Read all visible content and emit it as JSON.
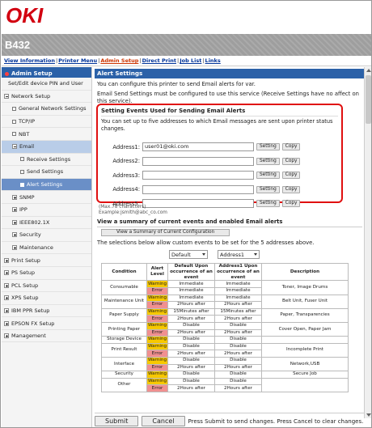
{
  "brand": {
    "logo": "OKI",
    "model": "B432"
  },
  "nav_links": [
    "View Information",
    "Printer Menu",
    "Admin Setup",
    "Direct Print",
    "Job List",
    "Links"
  ],
  "nav_active": "Admin Setup",
  "sidebar": {
    "header": "Admin Setup",
    "items": [
      {
        "label": "Set/Edit device PIN and User",
        "level": 0,
        "icon": "none"
      },
      {
        "label": "Network Setup",
        "level": 0,
        "icon": "minus"
      },
      {
        "label": "General Network Settings",
        "level": 1,
        "icon": "page"
      },
      {
        "label": "TCP/IP",
        "level": 1,
        "icon": "page"
      },
      {
        "label": "NBT",
        "level": 1,
        "icon": "page"
      },
      {
        "label": "Email",
        "level": 1,
        "icon": "minus",
        "state": "parent"
      },
      {
        "label": "Receive Settings",
        "level": 2,
        "icon": "page"
      },
      {
        "label": "Send Settings",
        "level": 2,
        "icon": "page"
      },
      {
        "label": "Alert Settings",
        "level": 2,
        "icon": "page",
        "state": "selected"
      },
      {
        "label": "SNMP",
        "level": 1,
        "icon": "plus"
      },
      {
        "label": "IPP",
        "level": 1,
        "icon": "plus"
      },
      {
        "label": "IEEE802.1X",
        "level": 1,
        "icon": "plus"
      },
      {
        "label": "Security",
        "level": 1,
        "icon": "plus"
      },
      {
        "label": "Maintenance",
        "level": 1,
        "icon": "plus"
      },
      {
        "label": "Print Setup",
        "level": 0,
        "icon": "plus"
      },
      {
        "label": "PS Setup",
        "level": 0,
        "icon": "plus"
      },
      {
        "label": "PCL Setup",
        "level": 0,
        "icon": "plus"
      },
      {
        "label": "XPS Setup",
        "level": 0,
        "icon": "plus"
      },
      {
        "label": "IBM PPR Setup",
        "level": 0,
        "icon": "plus"
      },
      {
        "label": "EPSON FX Setup",
        "level": 0,
        "icon": "plus"
      },
      {
        "label": "Management",
        "level": 0,
        "icon": "plus"
      }
    ]
  },
  "main": {
    "title": "Alert Settings",
    "intro": "You can configure this printer to send Email alerts for var.",
    "note": "Email Send Settings must be configured to use this service (Receive Settings have no affect on this service).",
    "box": {
      "title": "Setting Events Used for Sending Email Alerts",
      "desc": "You can set up to five addresses to which Email messages are sent upon printer status changes.",
      "addresses": [
        {
          "label": "Address1:",
          "value": "user01@oki.com"
        },
        {
          "label": "Address2:",
          "value": ""
        },
        {
          "label": "Address3:",
          "value": ""
        },
        {
          "label": "Address4:",
          "value": ""
        },
        {
          "label": "Address5:",
          "value": ""
        }
      ],
      "setting_btn": "Setting",
      "copy_btn": "Copy"
    },
    "max_note": "(Max.78 characters)",
    "example": "Example:jsmith@abc_co.com",
    "summary_title": "View a summary of current events and enabled Email alerts",
    "summary_btn": "View a Summary of Current Configuration",
    "selection_desc": "The selections below allow custom events to be set for the 5 addresses above.",
    "dropdown_left": "Default",
    "dropdown_right": "Address1",
    "table": {
      "headers": [
        "Condition",
        "Alert Level",
        "Default Upon occurrence of an event",
        "Address1 Upon occurrence of an event",
        "Description"
      ],
      "groups": [
        {
          "condition": "Consumable",
          "description": "Toner, Image Drums",
          "rows": [
            {
              "level": "Warning",
              "def": "Immediate",
              "addr": "Immediate"
            },
            {
              "level": "Error",
              "def": "Immediate",
              "addr": "Immediate"
            }
          ]
        },
        {
          "condition": "Maintenance Unit",
          "description": "Belt Unit, Fuser Unit",
          "rows": [
            {
              "level": "Warning",
              "def": "Immediate",
              "addr": "Immediate"
            },
            {
              "level": "Error",
              "def": "2Hours after",
              "addr": "2Hours after"
            }
          ]
        },
        {
          "condition": "Paper Supply",
          "description": "Paper, Transparencies",
          "rows": [
            {
              "level": "Warning",
              "def": "15Minutes after",
              "addr": "15Minutes after"
            },
            {
              "level": "Error",
              "def": "2Hours after",
              "addr": "2Hours after"
            }
          ]
        },
        {
          "condition": "Printing Paper",
          "description": "Cover Open, Paper Jam",
          "rows": [
            {
              "level": "Warning",
              "def": "Disable",
              "addr": "Disable"
            },
            {
              "level": "Error",
              "def": "2Hours after",
              "addr": "2Hours after"
            }
          ]
        },
        {
          "condition": "Storage Device",
          "description": "",
          "rows": [
            {
              "level": "Warning",
              "def": "Disable",
              "addr": "Disable"
            }
          ]
        },
        {
          "condition": "Print Result",
          "description": "Incomplete Print",
          "rows": [
            {
              "level": "Warning",
              "def": "Disable",
              "addr": "Disable"
            },
            {
              "level": "Error",
              "def": "2Hours after",
              "addr": "2Hours after"
            }
          ]
        },
        {
          "condition": "Interface",
          "description": "Network,USB",
          "rows": [
            {
              "level": "Warning",
              "def": "Disable",
              "addr": "Disable"
            },
            {
              "level": "Error",
              "def": "2Hours after",
              "addr": "2Hours after"
            }
          ]
        },
        {
          "condition": "Security",
          "description": "Secure Job",
          "rows": [
            {
              "level": "Warning",
              "def": "Disable",
              "addr": "Disable"
            }
          ]
        },
        {
          "condition": "Other",
          "description": "",
          "rows": [
            {
              "level": "Warning",
              "def": "Disable",
              "addr": "Disable"
            },
            {
              "level": "Error",
              "def": "2Hours after",
              "addr": "2Hours after"
            }
          ]
        }
      ]
    }
  },
  "footer": {
    "submit": "Submit",
    "cancel": "Cancel",
    "text": "Press Submit to send changes. Press Cancel to clear changes."
  },
  "colors": {
    "brand_red": "#d20010",
    "header_blue": "#2b61a8",
    "warning": "#f7c800",
    "error": "#f19090",
    "alert_box": "#e01010"
  }
}
